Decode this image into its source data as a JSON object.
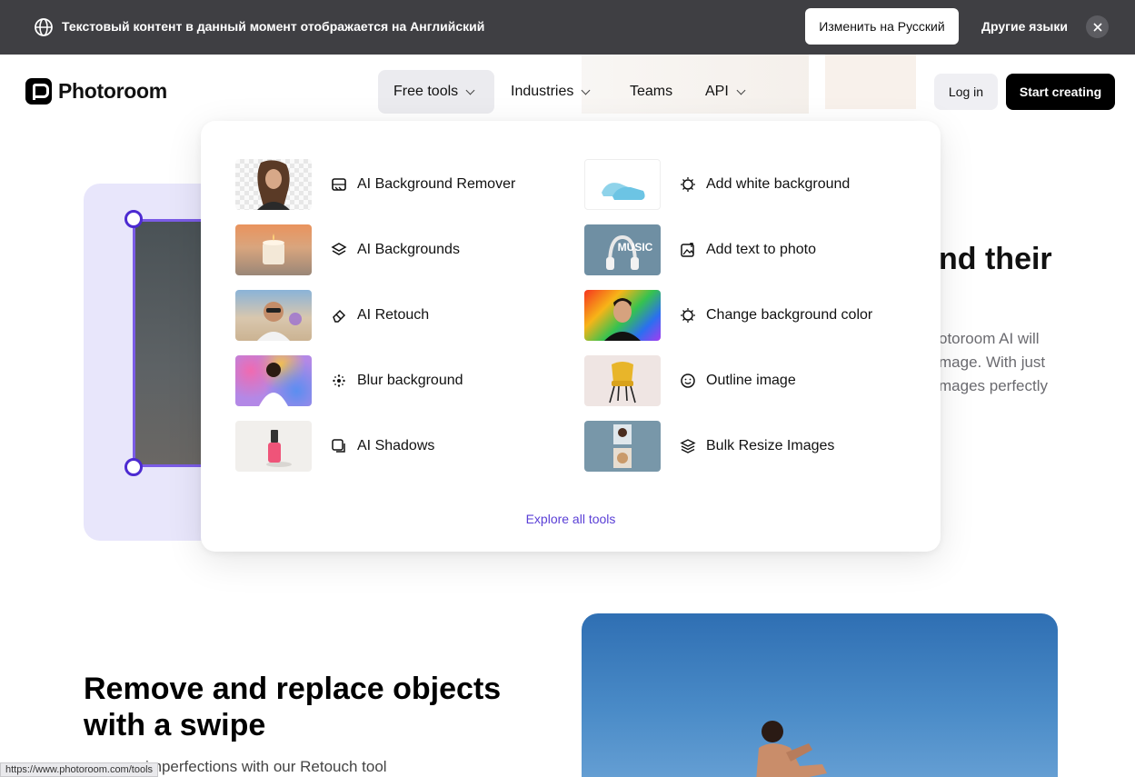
{
  "banner": {
    "message": "Текстовый контент в данный момент отображается на Английский",
    "switch_label": "Изменить на Русский",
    "other_languages": "Другие языки",
    "icons": {
      "globe": "globe-icon",
      "close": "close-icon"
    }
  },
  "header": {
    "brand": "Photoroom",
    "nav": [
      {
        "label": "Free tools",
        "has_dropdown": true,
        "active": true
      },
      {
        "label": "Industries",
        "has_dropdown": true
      },
      {
        "label": "Teams",
        "has_dropdown": false
      },
      {
        "label": "API",
        "has_dropdown": true
      }
    ],
    "login": "Log in",
    "cta": "Start creating"
  },
  "dropdown": {
    "left_tools": [
      {
        "label": "AI Background Remover",
        "icon": "background-remover-icon"
      },
      {
        "label": "AI Backgrounds",
        "icon": "layers-sparkle-icon"
      },
      {
        "label": "AI Retouch",
        "icon": "eraser-icon"
      },
      {
        "label": "Blur background",
        "icon": "blur-dots-icon"
      },
      {
        "label": "AI Shadows",
        "icon": "shadow-square-icon"
      }
    ],
    "right_tools": [
      {
        "label": "Add white background",
        "icon": "white-bg-icon"
      },
      {
        "label": "Add text to photo",
        "icon": "image-text-icon"
      },
      {
        "label": "Change background color",
        "icon": "color-bg-icon"
      },
      {
        "label": "Outline image",
        "icon": "smiley-outline-icon"
      },
      {
        "label": "Bulk Resize Images",
        "icon": "stack-icon"
      }
    ],
    "thumb_text": "MUSIC",
    "explore": "Explore all tools"
  },
  "page": {
    "heading_fragment": "nd their",
    "para_lines": [
      "otoroom AI will",
      "mage. With just",
      "mages perfectly"
    ],
    "section2_title": "Remove and replace objects with a swipe",
    "section2_sub": "pe away imperfections with our Retouch tool"
  },
  "status_bar": {
    "url": "https://www.photoroom.com/tools"
  },
  "colors": {
    "accent": "#5a3fd6",
    "banner_bg": "#3f3f43",
    "cta_bg": "#000000"
  }
}
